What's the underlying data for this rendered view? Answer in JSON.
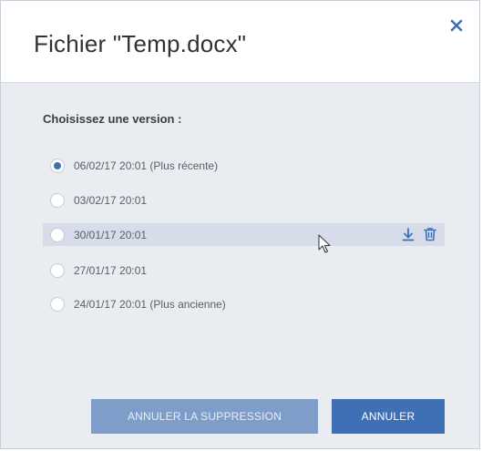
{
  "dialog": {
    "title": "Fichier \"Temp.docx\"",
    "close_icon": "close-icon"
  },
  "section": {
    "label": "Choisissez une version :"
  },
  "versions": [
    {
      "label": "06/02/17 20:01 (Plus récente)",
      "selected": true
    },
    {
      "label": "03/02/17 20:01",
      "selected": false
    },
    {
      "label": "30/01/17 20:01",
      "selected": false,
      "hovered": true
    },
    {
      "label": "27/01/17 20:01",
      "selected": false
    },
    {
      "label": "24/01/17 20:01 (Plus ancienne)",
      "selected": false
    }
  ],
  "row_actions": {
    "download_icon": "download-icon",
    "delete_icon": "trash-icon"
  },
  "buttons": {
    "restore_label": "ANNULER LA SUPPRESSION",
    "cancel_label": "ANNULER"
  },
  "colors": {
    "accent": "#3f6fb5",
    "accent_disabled": "#7f9dc9",
    "hover_row": "#d6dcea",
    "panel_bg": "#e9edf1"
  }
}
